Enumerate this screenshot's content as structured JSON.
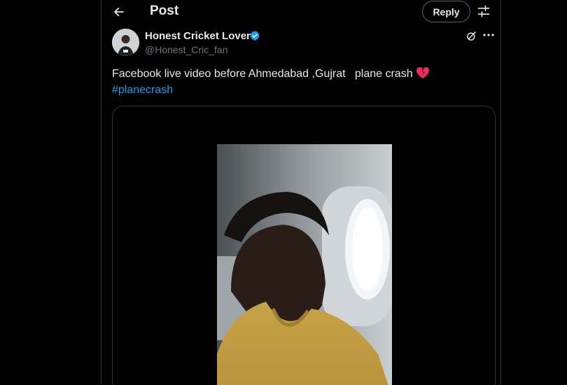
{
  "header": {
    "title": "Post",
    "reply_label": "Reply"
  },
  "author": {
    "name": "Honest Cricket Lover",
    "handle": "@Honest_Cric_fan",
    "verified": true
  },
  "post": {
    "text": "Facebook live video before Ahmedabad ,Gujrat   plane crash",
    "emoji": "broken-heart",
    "hashtag": "#planecrash"
  },
  "icons": {
    "back": "back-arrow-icon",
    "filter": "filter-sliders-icon",
    "verified": "verified-badge-icon",
    "grok": "grok-icon",
    "more": "more-icon",
    "heart": "broken-heart-icon"
  },
  "colors": {
    "background": "#000000",
    "text": "#e7e9ea",
    "secondary_text": "#71767b",
    "accent": "#1d9bf0",
    "border": "#2f3336"
  }
}
